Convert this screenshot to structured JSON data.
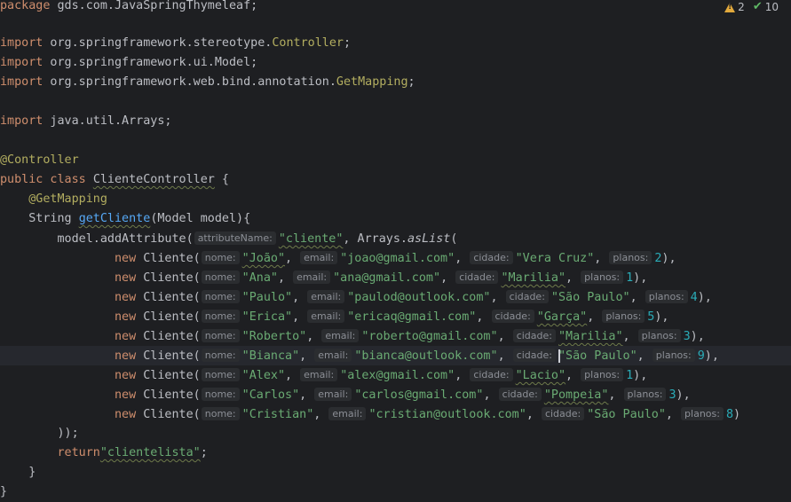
{
  "inspections": {
    "warnings": "2",
    "checks": "10",
    "warning_icon": "warning-triangle-icon",
    "check_icon": "double-check-icon"
  },
  "code": {
    "l1_kw": "package",
    "l1_rest": " gds.com.JavaSpringThymeleaf;",
    "imp": "import",
    "l3_a": " org.springframework.stereotype.",
    "l3_b": "Controller",
    "l3_c": ";",
    "l4_a": " org.springframework.ui.Model;",
    "l5_a": " org.springframework.web.bind.annotation.",
    "l5_b": "GetMapping",
    "l5_c": ";",
    "l7_a": " java.util.Arrays;",
    "l9": "@Controller",
    "l10_kw": "public class",
    "l10_cls": "ClienteController",
    "l10_rest": " {",
    "l11": "@GetMapping",
    "l12_a": "String ",
    "l12_fn": "getCliente",
    "l12_b": "(Model model){",
    "l13_a": "model.addAttribute(",
    "l13_hint": "attributeName:",
    "l13_str": "\"cliente\"",
    "l13_b": ", Arrays.",
    "l13_fn": "asList",
    "l13_c": "(",
    "new_kw": "new",
    "cliente_ctor": " Cliente(",
    "hint_nome": "nome:",
    "hint_email": "email:",
    "hint_cidade": "cidade:",
    "hint_planos": "planos:",
    "l24": "));",
    "l25_kw": "return",
    "l25_str": "\"clientelista\"",
    "l25_rest": ";",
    "l26": "}",
    "l27": "}"
  },
  "clientes": [
    {
      "nome": "\"João\"",
      "email": "\"joao@gmail.com\"",
      "cidade": "\"Vera Cruz\"",
      "planos": "2",
      "end": "),"
    },
    {
      "nome": "\"Ana\"",
      "email": "\"ana@gmail.com\"",
      "cidade": "\"Marilia\"",
      "planos": "1",
      "end": "),"
    },
    {
      "nome": "\"Paulo\"",
      "email": "\"paulod@outlook.com\"",
      "cidade": "\"São Paulo\"",
      "planos": "4",
      "end": "),"
    },
    {
      "nome": "\"Erica\"",
      "email": "\"ericaq@gmail.com\"",
      "cidade": "\"Garça\"",
      "planos": "5",
      "end": "),"
    },
    {
      "nome": "\"Roberto\"",
      "email": "\"roberto@gmail.com\"",
      "cidade": "\"Marilia\"",
      "planos": "3",
      "end": "),"
    },
    {
      "nome": "\"Bianca\"",
      "email": "\"bianca@outlook.com\"",
      "cidade": "\"São Paulo\"",
      "planos": "9",
      "end": "),"
    },
    {
      "nome": "\"Alex\"",
      "email": "\"alex@gmail.com\"",
      "cidade": "\"Lacio\"",
      "planos": "1",
      "end": "),"
    },
    {
      "nome": "\"Carlos\"",
      "email": "\"carlos@gmail.com\"",
      "cidade": "\"Pompeia\"",
      "planos": "3",
      "end": "),"
    },
    {
      "nome": "\"Cristian\"",
      "email": "\"cristian@outlook.com\"",
      "cidade": "\"São Paulo\"",
      "planos": "8",
      "end": ")"
    }
  ]
}
